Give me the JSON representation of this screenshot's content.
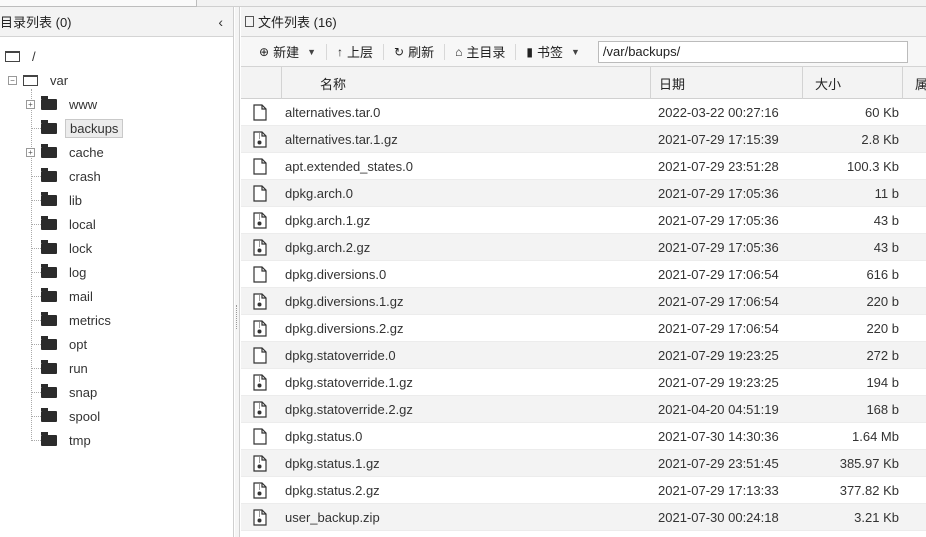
{
  "left_panel": {
    "title": "目录列表 (0)",
    "collapse_glyph": "‹",
    "tree": [
      {
        "label": "/",
        "level": 0,
        "icon": "folder-outline-icon",
        "toggle": ""
      },
      {
        "label": "var",
        "level": 1,
        "icon": "folder-outline-icon",
        "toggle": "−"
      },
      {
        "label": "www",
        "level": 2,
        "icon": "folder-icon",
        "toggle": "+"
      },
      {
        "label": "backups",
        "level": 2,
        "icon": "folder-icon",
        "toggle": "",
        "selected": true
      },
      {
        "label": "cache",
        "level": 2,
        "icon": "folder-icon",
        "toggle": "+"
      },
      {
        "label": "crash",
        "level": 2,
        "icon": "folder-icon",
        "toggle": ""
      },
      {
        "label": "lib",
        "level": 2,
        "icon": "folder-icon",
        "toggle": ""
      },
      {
        "label": "local",
        "level": 2,
        "icon": "folder-icon",
        "toggle": ""
      },
      {
        "label": "lock",
        "level": 2,
        "icon": "folder-icon",
        "toggle": ""
      },
      {
        "label": "log",
        "level": 2,
        "icon": "folder-icon",
        "toggle": ""
      },
      {
        "label": "mail",
        "level": 2,
        "icon": "folder-icon",
        "toggle": ""
      },
      {
        "label": "metrics",
        "level": 2,
        "icon": "folder-icon",
        "toggle": ""
      },
      {
        "label": "opt",
        "level": 2,
        "icon": "folder-icon",
        "toggle": ""
      },
      {
        "label": "run",
        "level": 2,
        "icon": "folder-icon",
        "toggle": ""
      },
      {
        "label": "snap",
        "level": 2,
        "icon": "folder-icon",
        "toggle": ""
      },
      {
        "label": "spool",
        "level": 2,
        "icon": "folder-icon",
        "toggle": ""
      },
      {
        "label": "tmp",
        "level": 2,
        "icon": "folder-icon",
        "toggle": ""
      }
    ]
  },
  "right_panel": {
    "title": "文件列表 (16)",
    "toolbar": {
      "new_label": "新建",
      "up_label": "上层",
      "refresh_label": "刷新",
      "home_label": "主目录",
      "bookmark_label": "书签",
      "path_value": "/var/backups/"
    },
    "columns": [
      "名称",
      "日期",
      "大小",
      "属"
    ],
    "files": [
      {
        "name": "alternatives.tar.0",
        "date": "2022-03-22 00:27:16",
        "size": "60 Kb",
        "icon": "file-icon"
      },
      {
        "name": "alternatives.tar.1.gz",
        "date": "2021-07-29 17:15:39",
        "size": "2.8 Kb",
        "icon": "archive-file-icon"
      },
      {
        "name": "apt.extended_states.0",
        "date": "2021-07-29 23:51:28",
        "size": "100.3 Kb",
        "icon": "file-icon"
      },
      {
        "name": "dpkg.arch.0",
        "date": "2021-07-29 17:05:36",
        "size": "11 b",
        "icon": "file-icon"
      },
      {
        "name": "dpkg.arch.1.gz",
        "date": "2021-07-29 17:05:36",
        "size": "43 b",
        "icon": "archive-file-icon"
      },
      {
        "name": "dpkg.arch.2.gz",
        "date": "2021-07-29 17:05:36",
        "size": "43 b",
        "icon": "archive-file-icon"
      },
      {
        "name": "dpkg.diversions.0",
        "date": "2021-07-29 17:06:54",
        "size": "616 b",
        "icon": "file-icon"
      },
      {
        "name": "dpkg.diversions.1.gz",
        "date": "2021-07-29 17:06:54",
        "size": "220 b",
        "icon": "archive-file-icon"
      },
      {
        "name": "dpkg.diversions.2.gz",
        "date": "2021-07-29 17:06:54",
        "size": "220 b",
        "icon": "archive-file-icon"
      },
      {
        "name": "dpkg.statoverride.0",
        "date": "2021-07-29 19:23:25",
        "size": "272 b",
        "icon": "file-icon"
      },
      {
        "name": "dpkg.statoverride.1.gz",
        "date": "2021-07-29 19:23:25",
        "size": "194 b",
        "icon": "archive-file-icon"
      },
      {
        "name": "dpkg.statoverride.2.gz",
        "date": "2021-04-20 04:51:19",
        "size": "168 b",
        "icon": "archive-file-icon"
      },
      {
        "name": "dpkg.status.0",
        "date": "2021-07-30 14:30:36",
        "size": "1.64 Mb",
        "icon": "file-icon"
      },
      {
        "name": "dpkg.status.1.gz",
        "date": "2021-07-29 23:51:45",
        "size": "385.97 Kb",
        "icon": "archive-file-icon"
      },
      {
        "name": "dpkg.status.2.gz",
        "date": "2021-07-29 17:13:33",
        "size": "377.82 Kb",
        "icon": "archive-file-icon"
      },
      {
        "name": "user_backup.zip",
        "date": "2021-07-30 00:24:18",
        "size": "3.21 Kb",
        "icon": "archive-file-icon"
      }
    ]
  }
}
